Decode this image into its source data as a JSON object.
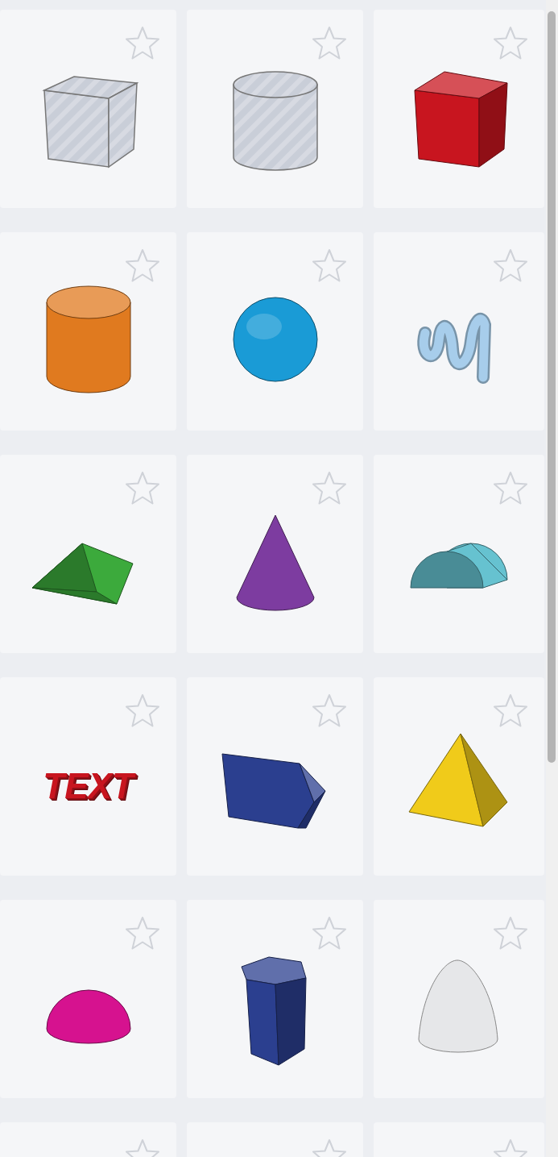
{
  "shapes": [
    {
      "kind": "box-hole",
      "color": "#c9ced8",
      "favorite": false
    },
    {
      "kind": "cylinder-hole",
      "color": "#c9ced8",
      "favorite": false
    },
    {
      "kind": "box",
      "color": "#c8151f",
      "favorite": false
    },
    {
      "kind": "cylinder",
      "color": "#e07a1f",
      "favorite": false
    },
    {
      "kind": "sphere",
      "color": "#1a9bd6",
      "favorite": false
    },
    {
      "kind": "scribble",
      "color": "#a7cdeb",
      "favorite": false
    },
    {
      "kind": "roof",
      "color": "#3caa3c",
      "favorite": false
    },
    {
      "kind": "cone",
      "color": "#7d3ca0",
      "favorite": false
    },
    {
      "kind": "round-roof",
      "color": "#66c2d0",
      "favorite": false
    },
    {
      "kind": "text",
      "color": "#c8151f",
      "favorite": false,
      "label": "TEXT"
    },
    {
      "kind": "wedge",
      "color": "#2b3f8f",
      "favorite": false
    },
    {
      "kind": "pyramid",
      "color": "#f0cb1a",
      "favorite": false
    },
    {
      "kind": "half-sphere",
      "color": "#d6128f",
      "favorite": false
    },
    {
      "kind": "polygon",
      "color": "#2b3f8f",
      "favorite": false
    },
    {
      "kind": "paraboloid",
      "color": "#e6e7e9",
      "favorite": false
    },
    {
      "kind": "hidden",
      "favorite": false
    },
    {
      "kind": "hidden",
      "favorite": false
    },
    {
      "kind": "hidden",
      "favorite": false
    }
  ]
}
